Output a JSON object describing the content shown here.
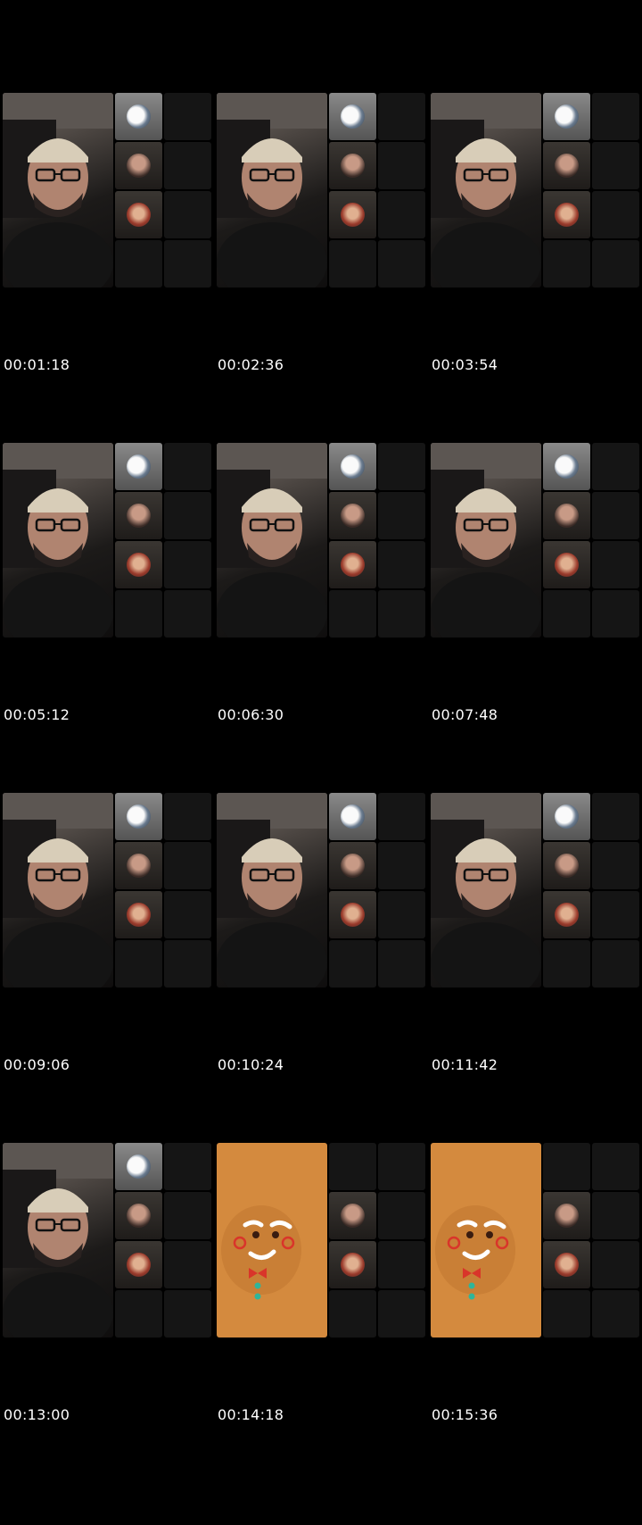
{
  "frames": [
    {
      "timestamp": "00:01:18",
      "main_video": "person",
      "participant_tiles": [
        "avatar-1",
        "avatar-2",
        "avatar-3",
        "empty",
        "empty",
        "empty",
        "empty",
        "empty"
      ]
    },
    {
      "timestamp": "00:02:36",
      "main_video": "person",
      "participant_tiles": [
        "avatar-1",
        "avatar-2",
        "avatar-3",
        "empty",
        "empty",
        "empty",
        "empty",
        "empty"
      ]
    },
    {
      "timestamp": "00:03:54",
      "main_video": "person",
      "participant_tiles": [
        "avatar-1",
        "avatar-2",
        "avatar-3",
        "empty",
        "empty",
        "empty",
        "empty",
        "empty"
      ]
    },
    {
      "timestamp": "00:05:12",
      "main_video": "person",
      "participant_tiles": [
        "avatar-1",
        "avatar-2",
        "avatar-3",
        "empty",
        "empty",
        "empty",
        "empty",
        "empty"
      ]
    },
    {
      "timestamp": "00:06:30",
      "main_video": "person",
      "participant_tiles": [
        "avatar-1",
        "avatar-2",
        "avatar-3",
        "empty",
        "empty",
        "empty",
        "empty",
        "empty"
      ]
    },
    {
      "timestamp": "00:07:48",
      "main_video": "person",
      "participant_tiles": [
        "avatar-1",
        "avatar-2",
        "avatar-3",
        "empty",
        "empty",
        "empty",
        "empty",
        "empty"
      ]
    },
    {
      "timestamp": "00:09:06",
      "main_video": "person",
      "participant_tiles": [
        "avatar-1",
        "avatar-2",
        "avatar-3",
        "empty",
        "empty",
        "empty",
        "empty",
        "empty"
      ]
    },
    {
      "timestamp": "00:10:24",
      "main_video": "person",
      "participant_tiles": [
        "avatar-1",
        "avatar-2",
        "avatar-3",
        "empty",
        "empty",
        "empty",
        "empty",
        "empty"
      ]
    },
    {
      "timestamp": "00:11:42",
      "main_video": "person",
      "participant_tiles": [
        "avatar-1",
        "avatar-2",
        "avatar-3",
        "empty",
        "empty",
        "empty",
        "empty",
        "empty"
      ]
    },
    {
      "timestamp": "00:13:00",
      "main_video": "person",
      "participant_tiles": [
        "avatar-1",
        "avatar-2",
        "avatar-3",
        "empty",
        "empty",
        "empty",
        "empty",
        "empty"
      ]
    },
    {
      "timestamp": "00:14:18",
      "main_video": "gingerbread-filter",
      "participant_tiles": [
        "empty",
        "avatar-2",
        "avatar-3",
        "empty",
        "empty",
        "empty",
        "empty",
        "empty"
      ]
    },
    {
      "timestamp": "00:15:36",
      "main_video": "gingerbread-filter",
      "participant_tiles": [
        "empty",
        "avatar-2",
        "avatar-3",
        "empty",
        "empty",
        "empty",
        "empty",
        "empty"
      ]
    }
  ],
  "colors": {
    "background": "#000000",
    "timestamp_text": "#ffffff",
    "gingerbread_bg": "#d48a3e",
    "empty_tile": "#151515"
  }
}
